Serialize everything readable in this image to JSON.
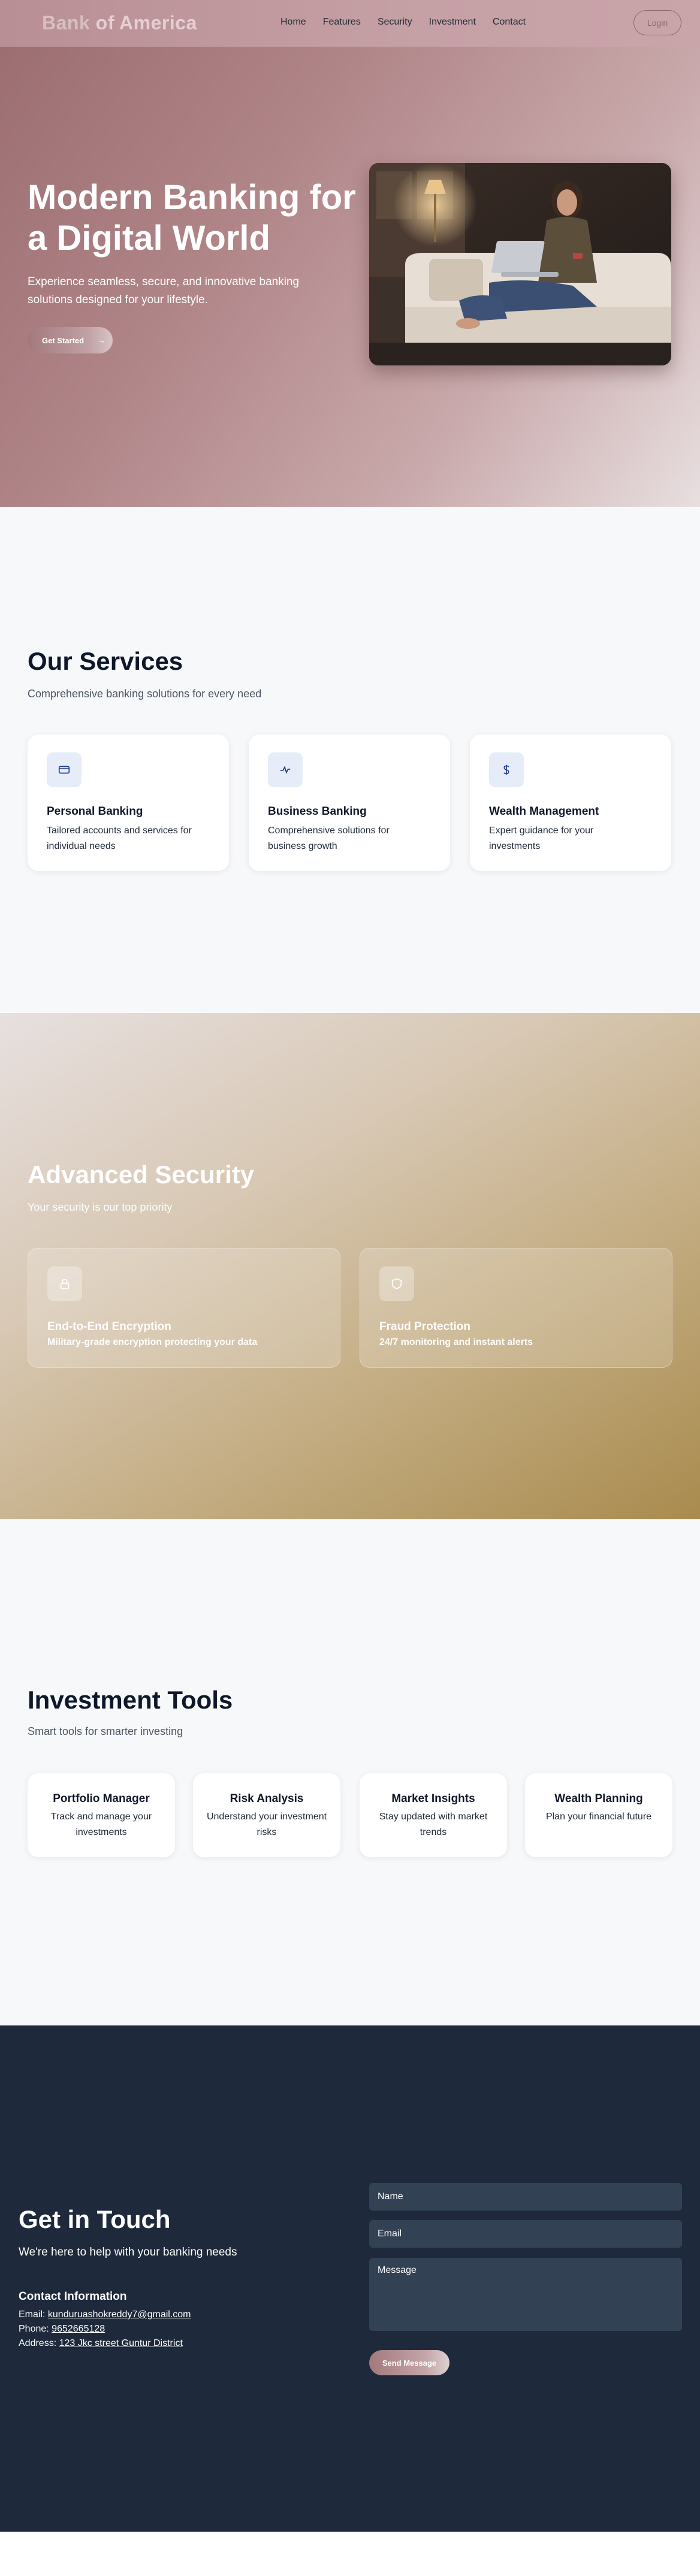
{
  "nav": {
    "logo_part1": "Bank",
    "logo_part2": "of America",
    "links": [
      "Home",
      "Features",
      "Security",
      "Investment",
      "Contact"
    ],
    "login_label": "Login"
  },
  "hero": {
    "title": "Modern Banking for a Digital World",
    "subtitle": "Experience seamless, secure, and innovative banking solutions designed for your lifestyle.",
    "cta_label": "Get Started",
    "cta_arrow": "→"
  },
  "services": {
    "title": "Our Services",
    "subtitle": "Comprehensive banking solutions for every need",
    "cards": [
      {
        "icon": "credit-card-icon",
        "name": "Personal Banking",
        "desc": "Tailored accounts and services for individual needs"
      },
      {
        "icon": "activity-icon",
        "name": "Business Banking",
        "desc": "Comprehensive solutions for business growth"
      },
      {
        "icon": "dollar-icon",
        "name": "Wealth Management",
        "desc": "Expert guidance for your investments"
      }
    ]
  },
  "security": {
    "title": "Advanced Security",
    "subtitle": "Your security is our top priority",
    "cards": [
      {
        "icon": "lock-icon",
        "name": "End-to-End Encryption",
        "desc": "Military-grade encryption protecting your data"
      },
      {
        "icon": "shield-icon",
        "name": "Fraud Protection",
        "desc": "24/7 monitoring and instant alerts"
      }
    ]
  },
  "investment": {
    "title": "Investment Tools",
    "subtitle": "Smart tools for smarter investing",
    "cards": [
      {
        "name": "Portfolio Manager",
        "desc": "Track and manage your investments"
      },
      {
        "name": "Risk Analysis",
        "desc": "Understand your investment risks"
      },
      {
        "name": "Market Insights",
        "desc": "Stay updated with market trends"
      },
      {
        "name": "Wealth Planning",
        "desc": "Plan your financial future"
      }
    ]
  },
  "contact": {
    "title": "Get in Touch",
    "subtitle": "We're here to help with your banking needs",
    "info_heading": "Contact Information",
    "email_label": "Email:",
    "email": "kunduruashokreddy7@gmail.com",
    "phone_label": "Phone:",
    "phone": "9652665128",
    "address_label": "Address:",
    "address": "123 Jkc street Guntur District",
    "name_placeholder": "Name",
    "email_placeholder": "Email",
    "message_placeholder": "Message",
    "send_label": "Send Message"
  },
  "colors": {
    "hero_start": "#9c6e72",
    "security_end": "#a98b4e",
    "contact_bg": "#1e293b",
    "card_icon_bg": "#e6ecf8"
  }
}
